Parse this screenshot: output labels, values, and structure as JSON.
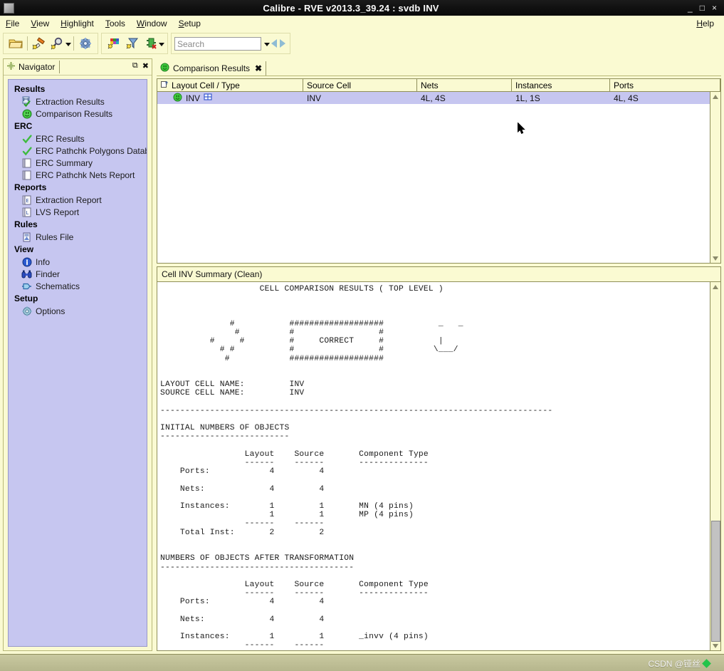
{
  "window": {
    "title": "Calibre - RVE v2013.3_39.24 : svdb INV",
    "minimize": "_",
    "maximize": "□",
    "close": "×"
  },
  "menubar": {
    "items": [
      {
        "label": "File",
        "accel": "F"
      },
      {
        "label": "View",
        "accel": "V"
      },
      {
        "label": "Highlight",
        "accel": "H"
      },
      {
        "label": "Tools",
        "accel": "T"
      },
      {
        "label": "Window",
        "accel": "W"
      },
      {
        "label": "Setup",
        "accel": "S"
      }
    ],
    "help": "Help"
  },
  "toolbar": {
    "buttons": [
      {
        "name": "open-folder-icon",
        "title": "Open"
      },
      {
        "name": "highlight-pen-icon",
        "title": "Highlight"
      },
      {
        "name": "zoom-search-icon",
        "title": "Zoom",
        "has_dropdown": true
      },
      {
        "name": "settings-gear-icon",
        "title": "Options"
      },
      {
        "name": "color-palette-icon",
        "title": "Colors"
      },
      {
        "name": "filter-funnel-icon",
        "title": "Filter"
      },
      {
        "name": "schematic-icon",
        "title": "Schematic",
        "has_dropdown": true
      }
    ],
    "search": {
      "placeholder": "Search",
      "value": "",
      "prev": "◀",
      "next": "▶"
    }
  },
  "navigator": {
    "tab_label": "Navigator",
    "undock_label": "⧉",
    "close_label": "✖",
    "sections": [
      {
        "title": "Results",
        "items": [
          {
            "label": "Extraction Results",
            "icon": "extraction-results-icon"
          },
          {
            "label": "Comparison Results",
            "icon": "green-smiley-icon"
          }
        ]
      },
      {
        "title": "ERC",
        "items": [
          {
            "label": "ERC Results",
            "icon": "green-check-icon"
          },
          {
            "label": "ERC Pathchk Polygons Databa",
            "icon": "green-check-icon"
          },
          {
            "label": "ERC Summary",
            "icon": "document-icon"
          },
          {
            "label": "ERC Pathchk Nets Report",
            "icon": "document-icon"
          }
        ]
      },
      {
        "title": "Reports",
        "items": [
          {
            "label": "Extraction Report",
            "icon": "report-e-icon"
          },
          {
            "label": "LVS Report",
            "icon": "report-l-icon"
          }
        ]
      },
      {
        "title": "Rules",
        "items": [
          {
            "label": "Rules File",
            "icon": "rules-file-icon"
          }
        ]
      },
      {
        "title": "View",
        "items": [
          {
            "label": "Info",
            "icon": "info-icon"
          },
          {
            "label": "Finder",
            "icon": "binoculars-icon"
          },
          {
            "label": "Schematics",
            "icon": "schematics-icon"
          }
        ]
      },
      {
        "title": "Setup",
        "items": [
          {
            "label": "Options",
            "icon": "gear-icon"
          }
        ]
      }
    ]
  },
  "results_tab": {
    "label": "Comparison Results",
    "icon": "green-smiley-icon",
    "close": "✖"
  },
  "results_table": {
    "columns": [
      "Layout Cell / Type",
      "Source Cell",
      "Nets",
      "Instances",
      "Ports"
    ],
    "rows": [
      {
        "layout_cell": "INV",
        "source_cell": "INV",
        "nets": "4L, 4S",
        "instances": "1L, 1S",
        "ports": "4L, 4S",
        "status_icon": "green-smiley-icon",
        "type_icon": "cell-type-icon",
        "selected": true
      }
    ]
  },
  "report": {
    "header": "Cell INV Summary (Clean)",
    "text": "                    CELL COMPARISON RESULTS ( TOP LEVEL )\n\n\n\n              #           ###################           _   _\n               #          #                 #\n          #     #         #     CORRECT     #           |\n            # #           #                 #          \\___/\n             #            ###################\n\n\nLAYOUT CELL NAME:         INV\nSOURCE CELL NAME:         INV\n\n-------------------------------------------------------------------------------\n\nINITIAL NUMBERS OF OBJECTS\n--------------------------\n\n                 Layout    Source       Component Type\n                 ------    ------       --------------\n    Ports:            4         4\n\n    Nets:             4         4\n\n    Instances:        1         1       MN (4 pins)\n                      1         1       MP (4 pins)\n                 ------    ------\n    Total Inst:       2         2\n\n\nNUMBERS OF OBJECTS AFTER TRANSFORMATION\n---------------------------------------\n\n                 Layout    Source       Component Type\n                 ------    ------       --------------\n    Ports:            4         4\n\n    Nets:             4         4\n\n    Instances:        1         1       _invv (4 pins)\n                 ------    ------",
    "ascii_banner": {
      "check_rows": [
        "              #",
        "               #",
        "          #     #",
        "            # #",
        "             #"
      ],
      "box_label": "CORRECT",
      "face": "smiley-face-ascii"
    }
  },
  "summary_values": {
    "layout_cell_name": "INV",
    "source_cell_name": "INV",
    "initial": {
      "ports": {
        "layout": 4,
        "source": 4
      },
      "nets": {
        "layout": 4,
        "source": 4
      },
      "instances": [
        {
          "layout": 1,
          "source": 1,
          "type": "MN (4 pins)"
        },
        {
          "layout": 1,
          "source": 1,
          "type": "MP (4 pins)"
        }
      ],
      "total_inst": {
        "layout": 2,
        "source": 2
      }
    },
    "after_transformation": {
      "ports": {
        "layout": 4,
        "source": 4
      },
      "nets": {
        "layout": 4,
        "source": 4
      },
      "instances": [
        {
          "layout": 1,
          "source": 1,
          "type": "_invv (4 pins)"
        }
      ]
    }
  },
  "statusbar": {
    "watermark": "CSDN @铔丝"
  },
  "colors": {
    "window_bg": "#fafad2",
    "selection": "#c6c6f0",
    "title_bar": "#111111",
    "border": "#8f8f5a",
    "accent_green": "#23c44a"
  }
}
